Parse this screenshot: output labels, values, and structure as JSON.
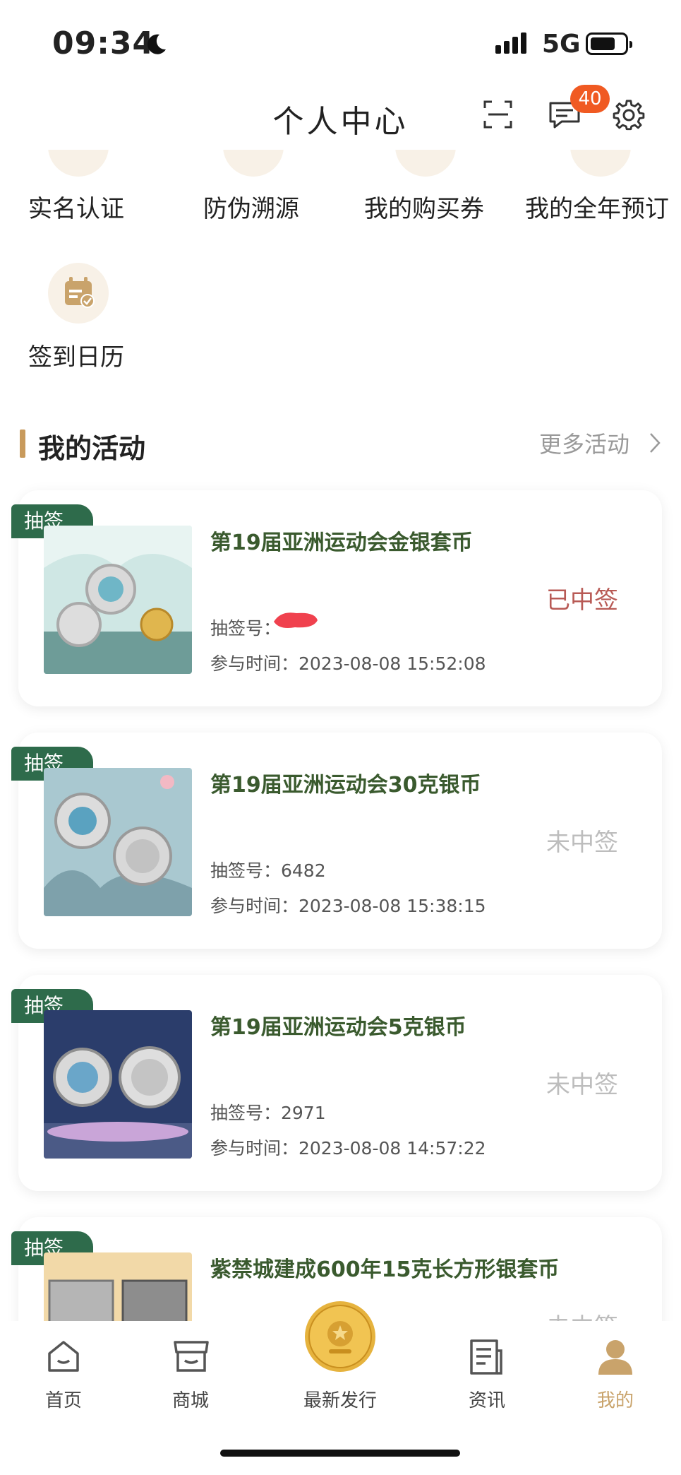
{
  "status_bar": {
    "time": "09:34",
    "network": "5G"
  },
  "header": {
    "title": "个人中心",
    "message_badge": "40"
  },
  "quick_menu": [
    {
      "label": "实名认证",
      "icon": "id-verify-icon"
    },
    {
      "label": "防伪溯源",
      "icon": "anti-counterfeit-icon"
    },
    {
      "label": "我的购买券",
      "icon": "voucher-icon"
    },
    {
      "label": "我的全年预订",
      "icon": "annual-booking-icon"
    },
    {
      "label": "签到日历",
      "icon": "checkin-calendar-icon"
    }
  ],
  "section": {
    "title": "我的活动",
    "more": "更多活动"
  },
  "activities": [
    {
      "tag": "抽签",
      "title": "第19届亚洲运动会金银套币",
      "number": "抽签号：",
      "time": "参与时间：2023-08-08 15:52:08",
      "status": "已中签"
    },
    {
      "tag": "抽签",
      "title": "第19届亚洲运动会30克银币",
      "number": "抽签号：6482",
      "time": "参与时间：2023-08-08 15:38:15",
      "status": "未中签"
    },
    {
      "tag": "抽签",
      "title": "第19届亚洲运动会5克银币",
      "number": "抽签号：2971",
      "time": "参与时间：2023-08-08 14:57:22",
      "status": "未中签"
    },
    {
      "tag": "抽签",
      "title": "紫禁城建成600年15克长方形银套币",
      "number": "",
      "time": "",
      "status": "未中签"
    }
  ],
  "tabs": [
    {
      "label": "首页",
      "icon": "home-icon"
    },
    {
      "label": "商城",
      "icon": "store-icon"
    },
    {
      "label": "最新发行",
      "icon": "coin-icon"
    },
    {
      "label": "资讯",
      "icon": "news-icon"
    },
    {
      "label": "我的",
      "icon": "profile-icon"
    }
  ],
  "colors": {
    "accent": "#c9a36b",
    "tag_green": "#2e6b4b",
    "won_red": "#b85a55",
    "badge": "#f05a22"
  }
}
